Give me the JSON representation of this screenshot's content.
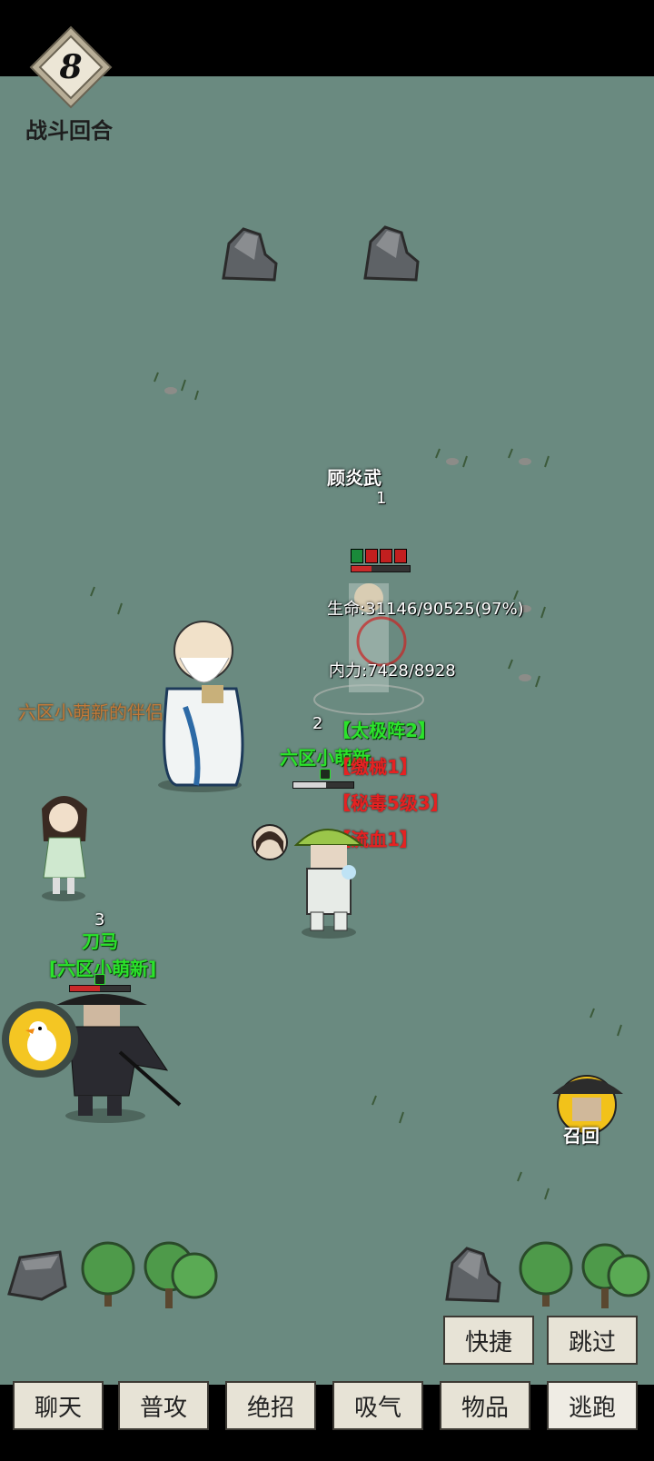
{
  "battle": {
    "round_number": "8",
    "round_label": "战斗回合"
  },
  "enemy": {
    "name": "顾炎武",
    "position_number": "1",
    "hp_text": "生命:31146/90525(97%)",
    "mp_text": "内力:7428/8928"
  },
  "player": {
    "position_number": "2",
    "name": "六区小萌新",
    "buffs": [
      "【太极阵2】",
      "【缴械1】",
      "【秘毒5级3】",
      "【流血1】"
    ]
  },
  "companion": {
    "label": "六区小萌新的伴侣"
  },
  "pet": {
    "position_number": "3",
    "name": "刀马",
    "owner": "[六区小萌新]"
  },
  "recall": {
    "label": "召回"
  },
  "action_buttons": {
    "shortcut": "快捷",
    "skip": "跳过"
  },
  "menu": {
    "chat": "聊天",
    "attack": "普攻",
    "ultimate": "绝招",
    "absorb": "吸气",
    "items": "物品",
    "flee": "逃跑"
  },
  "colors": {
    "field": "#6a8a80",
    "green_text": "#2be32b",
    "red_text": "#e52222",
    "companion_label": "#c17a3a"
  }
}
